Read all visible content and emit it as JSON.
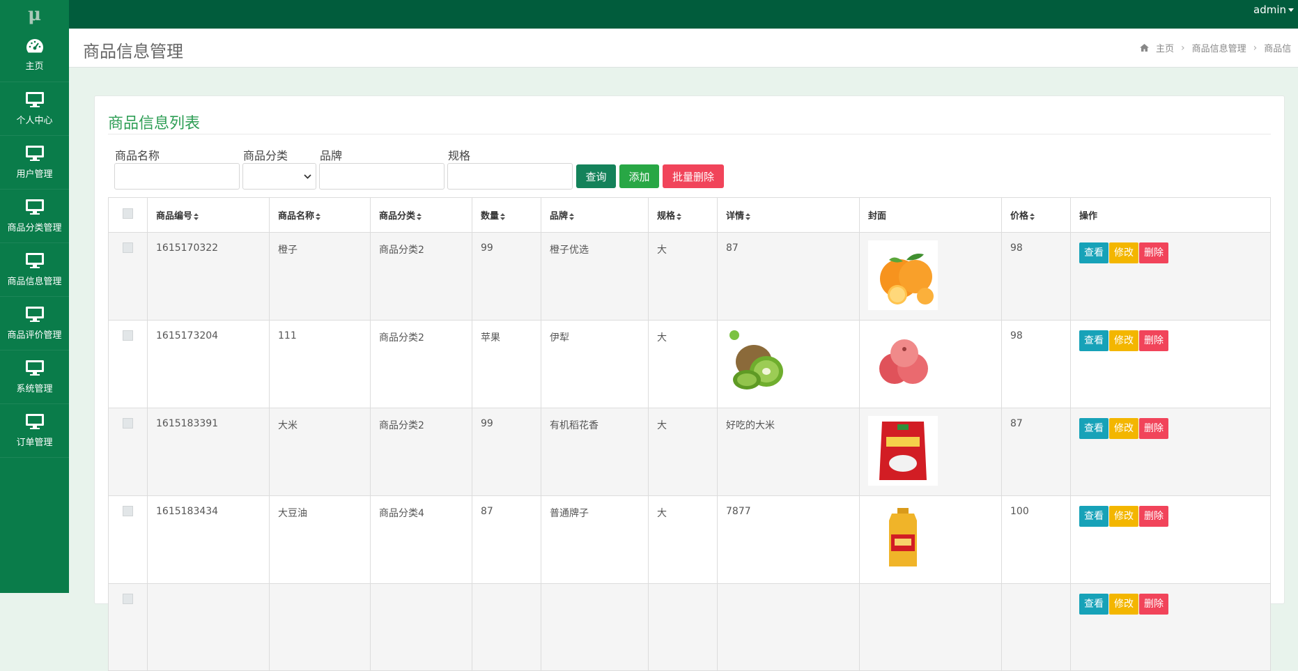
{
  "app": {
    "logo": "μ",
    "user": "admin"
  },
  "sidebar": {
    "items": [
      {
        "label": "主页",
        "icon": "dashboard-icon"
      },
      {
        "label": "个人中心",
        "icon": "monitor-icon"
      },
      {
        "label": "用户管理",
        "icon": "monitor-icon"
      },
      {
        "label": "商品分类管理",
        "icon": "monitor-icon"
      },
      {
        "label": "商品信息管理",
        "icon": "monitor-icon"
      },
      {
        "label": "商品评价管理",
        "icon": "monitor-icon"
      },
      {
        "label": "系统管理",
        "icon": "monitor-icon"
      },
      {
        "label": "订单管理",
        "icon": "monitor-icon"
      }
    ]
  },
  "header": {
    "title": "商品信息管理",
    "breadcrumb": [
      "主页",
      "商品信息管理",
      "商品信"
    ]
  },
  "card": {
    "title": "商品信息列表"
  },
  "search": {
    "name_label": "商品名称",
    "category_label": "商品分类",
    "brand_label": "品牌",
    "spec_label": "规格",
    "name_value": "",
    "category_value": "",
    "brand_value": "",
    "spec_value": ""
  },
  "buttons": {
    "query": "查询",
    "add": "添加",
    "batch_delete": "批量删除"
  },
  "table": {
    "columns": [
      "商品编号",
      "商品名称",
      "商品分类",
      "数量",
      "品牌",
      "规格",
      "详情",
      "封面",
      "价格",
      "操作"
    ],
    "row_actions": {
      "view": "查看",
      "edit": "修改",
      "delete": "删除"
    },
    "rows": [
      {
        "id": "1615170322",
        "name": "橙子",
        "category": "商品分类2",
        "qty": "99",
        "brand": "橙子优选",
        "spec": "大",
        "detail": "87",
        "cover": "orange-image",
        "price": "98"
      },
      {
        "id": "1615173204",
        "name": "111",
        "category": "商品分类2",
        "qty": "苹果",
        "brand": "伊犁",
        "spec": "大",
        "detail": "",
        "detail_image": "kiwi-image",
        "cover": "apple-image",
        "price": "98"
      },
      {
        "id": "1615183391",
        "name": "大米",
        "category": "商品分类2",
        "qty": "99",
        "brand": "有机稻花香",
        "spec": "大",
        "detail": "好吃的大米",
        "cover": "rice-bag-image",
        "price": "87"
      },
      {
        "id": "1615183434",
        "name": "大豆油",
        "category": "商品分类4",
        "qty": "87",
        "brand": "普通牌子",
        "spec": "大",
        "detail": "7877",
        "cover": "oil-bottle-image",
        "price": "100"
      }
    ]
  },
  "colors": {
    "topbar": "#015c3c",
    "sidebar": "#0a7c4a",
    "title_green": "#2e9e55",
    "query": "#14825a",
    "add": "#28a745",
    "batch_delete": "#f1445a",
    "view": "#17a2b8",
    "edit": "#f3b600",
    "delete": "#f1445a"
  }
}
